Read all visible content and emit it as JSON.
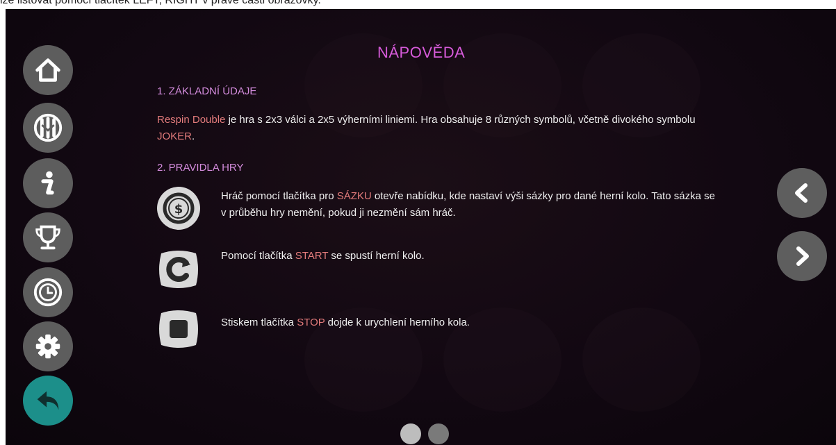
{
  "caption": "lze listovat pomocí tlačítek LEFT, RIGHT v pravé části obrazovky.",
  "title": "NÁPOVĚDA",
  "section1": {
    "heading": "1. ZÁKLADNÍ ÚDAJE",
    "game_name": "Respin Double",
    "text_a": " je hra s 2x3 válci a 2x5 výherními liniemi. Hra obsahuje 8 různých symbolů, včetně divokého symbolu ",
    "joker": "JOKER",
    "text_b": "."
  },
  "section2": {
    "heading": "2. PRAVIDLA HRY",
    "rules": [
      {
        "icon": "bet-coin-icon",
        "before": "Hráč pomocí tlačítka pro ",
        "keyword": "SÁZKU",
        "after": " otevře nabídku, kde nastaví výši sázky pro dané herní kolo. Tato sázka se v průběhu hry nemění, pokud ji nezmění sám hráč."
      },
      {
        "icon": "start-spin-icon",
        "before": "Pomocí tlačítka ",
        "keyword": "START",
        "after": " se spustí herní kolo."
      },
      {
        "icon": "stop-square-icon",
        "before": "Stiskem tlačítka ",
        "keyword": "STOP",
        "after": " dojde k urychlení herního kola."
      }
    ]
  },
  "menu": [
    "home-icon",
    "paytable-icon",
    "info-icon",
    "trophy-icon",
    "history-clock-icon",
    "settings-gear-icon",
    "back-arrow-icon"
  ],
  "pagination": {
    "pages": 2,
    "current": 1
  },
  "colors": {
    "title": "#d65ad9",
    "heading": "#d48cdd",
    "highlight": "#e27b7b",
    "back": "#1c8f8a",
    "button": "#5d5d5d"
  }
}
